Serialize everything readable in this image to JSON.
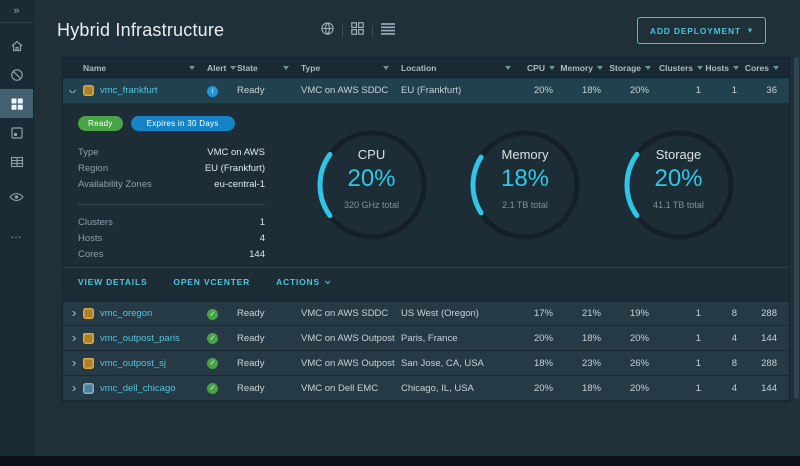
{
  "header": {
    "title": "Hybrid Infrastructure",
    "add_button_label": "ADD DEPLOYMENT"
  },
  "icons": {
    "expand": "»",
    "caret_down": "▾",
    "ellipsis": "…",
    "check": "✓",
    "info": "i",
    "view_icons": [
      "globe-view-icon",
      "card-view-icon",
      "list-view-icon"
    ],
    "sidebar_icons": [
      "expand-sidebar-icon",
      "home-icon",
      "no-entry-icon",
      "infrastructure-grid-icon",
      "panel-icon",
      "table-icon",
      "eye-icon",
      "ellipsis-icon"
    ]
  },
  "table": {
    "columns": [
      "Name",
      "Alert",
      "State",
      "Type",
      "Location",
      "CPU",
      "Memory",
      "Storage",
      "Clusters",
      "Hosts",
      "Cores"
    ],
    "rows": [
      {
        "name": "vmc_frankfurt",
        "alert": "info",
        "state": "Ready",
        "type": "VMC on AWS SDDC",
        "location": "EU (Frankfurt)",
        "cpu": "20%",
        "memory": "18%",
        "storage": "20%",
        "clusters": "1",
        "hosts": "1",
        "cores": "36"
      },
      {
        "name": "vmc_oregon",
        "alert": "ok",
        "state": "Ready",
        "type": "VMC on AWS SDDC",
        "location": "US West (Oregon)",
        "cpu": "17%",
        "memory": "21%",
        "storage": "19%",
        "clusters": "1",
        "hosts": "8",
        "cores": "288"
      },
      {
        "name": "vmc_outpost_paris",
        "alert": "ok",
        "state": "Ready",
        "type": "VMC on AWS Outpost",
        "location": "Paris, France",
        "cpu": "20%",
        "memory": "18%",
        "storage": "20%",
        "clusters": "1",
        "hosts": "4",
        "cores": "144"
      },
      {
        "name": "vmc_outpost_sj",
        "alert": "ok",
        "state": "Ready",
        "type": "VMC on AWS Outpost",
        "location": "San Jose, CA, USA",
        "cpu": "18%",
        "memory": "23%",
        "storage": "26%",
        "clusters": "1",
        "hosts": "8",
        "cores": "288"
      },
      {
        "name": "vmc_dell_chicago",
        "alert": "ok",
        "state": "Ready",
        "type": "VMC on Dell EMC",
        "location": "Chicago, IL, USA",
        "cpu": "20%",
        "memory": "18%",
        "storage": "20%",
        "clusters": "1",
        "hosts": "4",
        "cores": "144"
      }
    ]
  },
  "detail": {
    "badges": [
      {
        "label": "Ready",
        "color": "#49a447"
      },
      {
        "label": "Expires in 30 Days",
        "color": "#1583c5"
      }
    ],
    "fields": [
      {
        "label": "Type",
        "value": "VMC on AWS"
      },
      {
        "label": "Region",
        "value": "EU (Frankfurt)"
      },
      {
        "label": "Availability Zones",
        "value": "eu-central-1"
      }
    ],
    "stats": [
      {
        "label": "Clusters",
        "value": "1"
      },
      {
        "label": "Hosts",
        "value": "4"
      },
      {
        "label": "Cores",
        "value": "144"
      }
    ],
    "actions": [
      "VIEW DETAILS",
      "OPEN VCENTER",
      "ACTIONS"
    ]
  },
  "gauges": [
    {
      "label": "CPU",
      "value": "20%",
      "percent": 20,
      "total": "320 GHz total"
    },
    {
      "label": "Memory",
      "value": "18%",
      "percent": 18,
      "total": "2.1 TB total"
    },
    {
      "label": "Storage",
      "value": "20%",
      "percent": 20,
      "total": "41.1 TB total"
    }
  ],
  "colors": {
    "accent_cyan": "#31c6e8",
    "link_teal": "#56c4dc",
    "badge_green": "#49a447",
    "badge_blue": "#1583c5",
    "alert_info_blue": "#1f96d8",
    "alert_ok_green": "#48a447",
    "background": "#1f3039",
    "sidebar": "#1b2b36",
    "row": "#263a45",
    "row_expanded": "#21414e",
    "panel": "#1c2d36"
  }
}
